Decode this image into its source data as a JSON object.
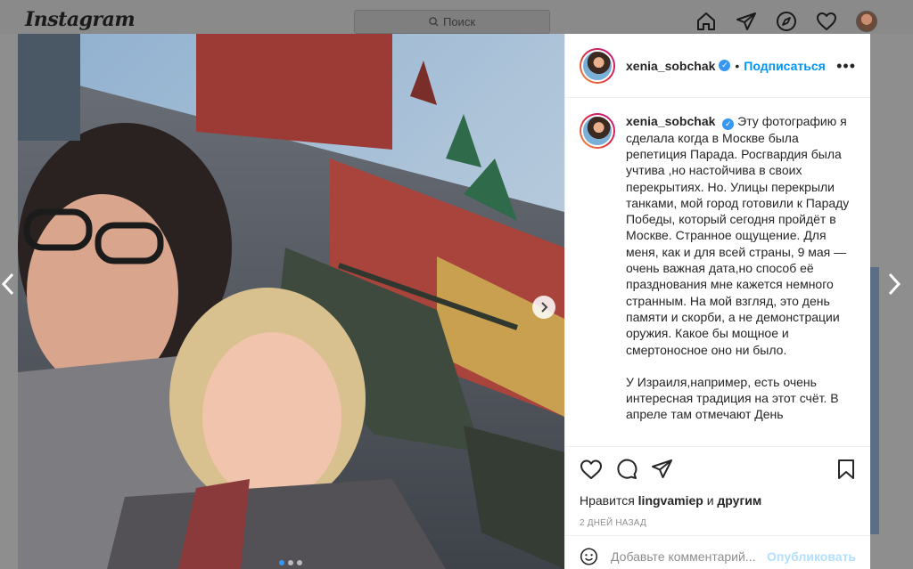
{
  "app": {
    "logo": "Instagram"
  },
  "search": {
    "placeholder": "Поиск"
  },
  "nav": {
    "icons": [
      "home-icon",
      "direct-icon",
      "explore-icon",
      "activity-heart-icon",
      "profile-avatar"
    ]
  },
  "post": {
    "username": "xenia_sobchak",
    "verified": true,
    "separator": "•",
    "follow_label": "Подписаться",
    "more_label": "•••",
    "caption_paragraphs": [
      "Эту фотографию я сделала когда в Москве была репетиция Парада. Росгвардия была учтива ,но настойчива в своих перекрытиях. Но. Улицы перекрыли танками, мой город готовили к Параду Победы, который сегодня пройдёт в Москве. Странное ощущение. Для меня, как и для всей страны, 9 мая — очень важная дата,но способ её празднования мне кажется немного странным. На мой взгляд, это день памяти и скорби, а не демонстрации оружия. Какое бы мощное и смертоносное оно ни было.",
      "У Израиля,например, есть очень интересная традиция на этот счёт. В апреле там отмечают День"
    ],
    "likes_prefix": "Нравится",
    "likes_user": "lingvamiep",
    "likes_conj": "и",
    "likes_others": "другим",
    "time_ago": "2 ДНЕЙ НАЗАД",
    "comment_placeholder": "Добавьте комментарий...",
    "publish_label": "Опубликовать",
    "carousel": {
      "slides": 3,
      "active_index": 0
    }
  },
  "colors": {
    "accent": "#0095f6",
    "verified": "#3897f0",
    "publish_disabled": "#b2dffc"
  }
}
